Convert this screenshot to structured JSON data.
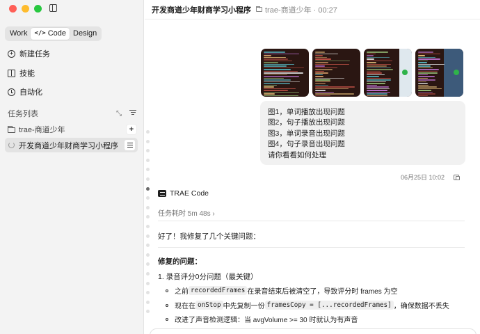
{
  "sidebar": {
    "modes": [
      "Work",
      "Code",
      "Design"
    ],
    "active_mode": "Code",
    "nav": {
      "new_task": "新建任务",
      "skills": "技能",
      "automation": "自动化"
    },
    "task_list_title": "任务列表",
    "folder": "trae-商道少年",
    "task": "开发商道少年财商学习小程序"
  },
  "header": {
    "title": "开发商道少年财商学习小程序",
    "subtitle": "trae-商道少年 · 00:27"
  },
  "message": {
    "lines": [
      "图1，单词播放出现问题",
      "图2，句子播放出现问题",
      "图3，单词录音出现问题",
      "图4，句子录音出现问题",
      "请你看看如何处理"
    ],
    "timestamp": "06月25日 10:02"
  },
  "reply": {
    "agent": "TRAE Code",
    "duration": "任务耗时 5m 48s",
    "intro": "好了！我修复了几个关键问题：",
    "section": "修复的问题：",
    "item1": "1. 录音评分0分问题（最关键）",
    "b1": {
      "a": "之前 ",
      "code": "recordedFrames",
      "b": " 在录音结束后被清空了，导致评分时 frames 为空"
    },
    "b2": {
      "a": "现在在 ",
      "code1": "onStop",
      "b": " 中先复制一份 ",
      "code2": "framesCopy = [...recordedFrames]",
      "c": "，确保数据不丢失"
    },
    "b3": "改进了声音检测逻辑：当 avgVolume >= 30 时就认为有声音"
  },
  "colors": {
    "sidebar_bg": "#f3f3f3",
    "bubble_bg": "#f1f1f1",
    "accent_dark": "#1f1f1f"
  }
}
